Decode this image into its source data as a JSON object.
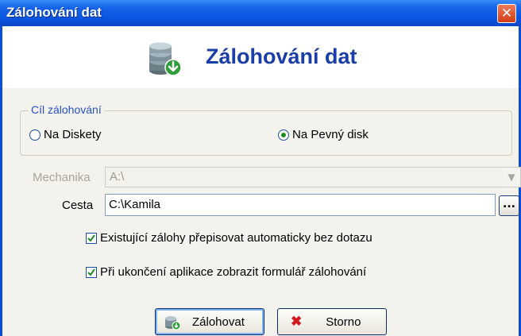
{
  "window": {
    "title": "Zálohování dat",
    "close_glyph": "✕"
  },
  "header": {
    "title": "Zálohování dat",
    "icon": "database-restore-icon"
  },
  "target_group": {
    "legend": "Cíl zálohování",
    "options": [
      {
        "label": "Na Diskety",
        "selected": false
      },
      {
        "label": "Na Pevný disk",
        "selected": true
      }
    ]
  },
  "drive": {
    "label": "Mechanika",
    "value": "A:\\",
    "enabled": false
  },
  "path": {
    "label": "Cesta",
    "value": "C:\\Kamila",
    "browse_label": "..."
  },
  "options": {
    "overwrite": {
      "label": "Existující zálohy přepisovat automaticky bez dotazu",
      "checked": true
    },
    "show_on_exit": {
      "label": "Při ukončení aplikace zobrazit formulář zálohování",
      "checked": true
    }
  },
  "buttons": {
    "backup": "Zálohovat",
    "cancel": "Storno"
  }
}
